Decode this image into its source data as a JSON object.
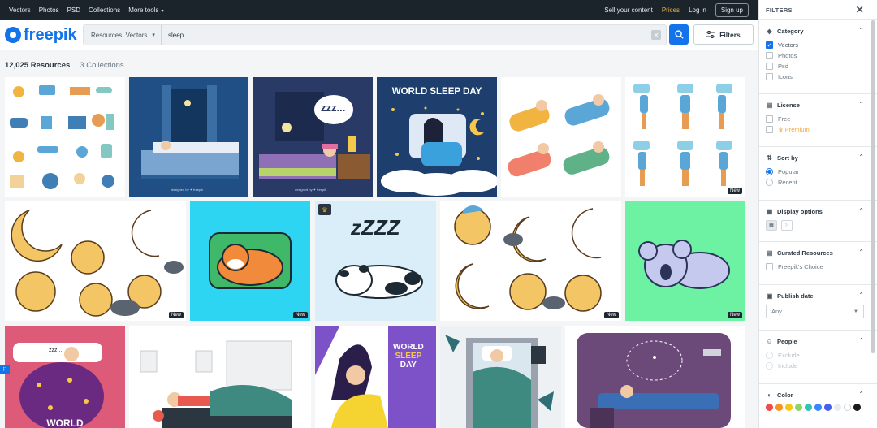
{
  "topnav": {
    "items": [
      "Vectors",
      "Photos",
      "PSD",
      "Collections",
      "More tools"
    ],
    "right": {
      "sell": "Sell your content",
      "prices": "Prices",
      "login": "Log in",
      "signup": "Sign up"
    }
  },
  "search": {
    "logo": "freepik",
    "scope": "Resources, Vectors",
    "query": "sleep",
    "filters_label": "Filters"
  },
  "results": {
    "count": "12,025 Resources",
    "collections": "3 Collections",
    "badge_new": "New",
    "tile_texts": {
      "world_sleep_day": "WORLD SLEEP DAY",
      "zzz": "zzz...",
      "designed_by": "designed by ✦ freepik",
      "zzZZ": "zZZZ",
      "world_sleep_day_2": [
        "WORLD",
        "SLEEP",
        "DAY"
      ],
      "world": "WORLD"
    }
  },
  "filters": {
    "header": "FILTERS",
    "category": {
      "title": "Category",
      "options": [
        {
          "label": "Vectors",
          "checked": true
        },
        {
          "label": "Photos",
          "checked": false
        },
        {
          "label": "Psd",
          "checked": false
        },
        {
          "label": "Icons",
          "checked": false
        }
      ]
    },
    "license": {
      "title": "License",
      "options": [
        "Free",
        "Premium"
      ]
    },
    "sort": {
      "title": "Sort by",
      "options": [
        "Popular",
        "Recent"
      ],
      "selected": "Popular"
    },
    "display": {
      "title": "Display options"
    },
    "curated": {
      "title": "Curated Resources",
      "option": "Freepik's Choice"
    },
    "publish": {
      "title": "Publish date",
      "value": "Any"
    },
    "people": {
      "title": "People",
      "options": [
        "Exclude",
        "Include"
      ]
    },
    "color": {
      "title": "Color",
      "swatches": [
        "#f04b4b",
        "#f7931e",
        "#f5c518",
        "#8bd36b",
        "#2ec4b6",
        "#3a86ff",
        "#4361ee",
        "#e9ecef",
        "#ffffff",
        "#1b1b1b"
      ]
    }
  },
  "colors": {
    "accent": "#1273eb",
    "topbar": "#1b232b",
    "prices": "#f0b33a"
  }
}
